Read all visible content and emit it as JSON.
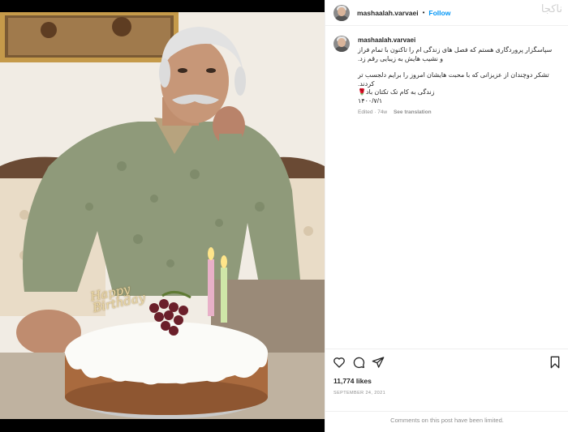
{
  "post": {
    "username": "mashaalah.varvaei",
    "follow_label": "Follow",
    "separator": "•",
    "watermark": "ناکجا",
    "caption_lines": [
      "سپاسگزار پروردگاری هستم که فصل های زندگی ام را تاکنون با تمام فراز",
      "و نشیب هایش به زیبایی رقم زد."
    ],
    "caption_lines_2": [
      "تشکر دوچندان از عزیزانی که با محبت هایشان امروز را برایم دلجسب تر",
      "کردند.",
      "زندگی به کام تک تکتان باد🌹",
      "۱۴۰۰/۷/۱"
    ],
    "meta_edited": "Edited · 74w",
    "meta_translation": "See translation",
    "likes": "11,774 likes",
    "date": "SEPTEMBER 24, 2021",
    "comments_off": "Comments on this post have been limited.",
    "cake_topper": "Happy Birthday"
  },
  "icons": {
    "like": "heart-icon",
    "comment": "comment-icon",
    "share": "paper-plane-icon",
    "save": "bookmark-icon"
  },
  "colors": {
    "follow": "#0095f6",
    "muted": "#8e8e8e",
    "text": "#262626"
  }
}
